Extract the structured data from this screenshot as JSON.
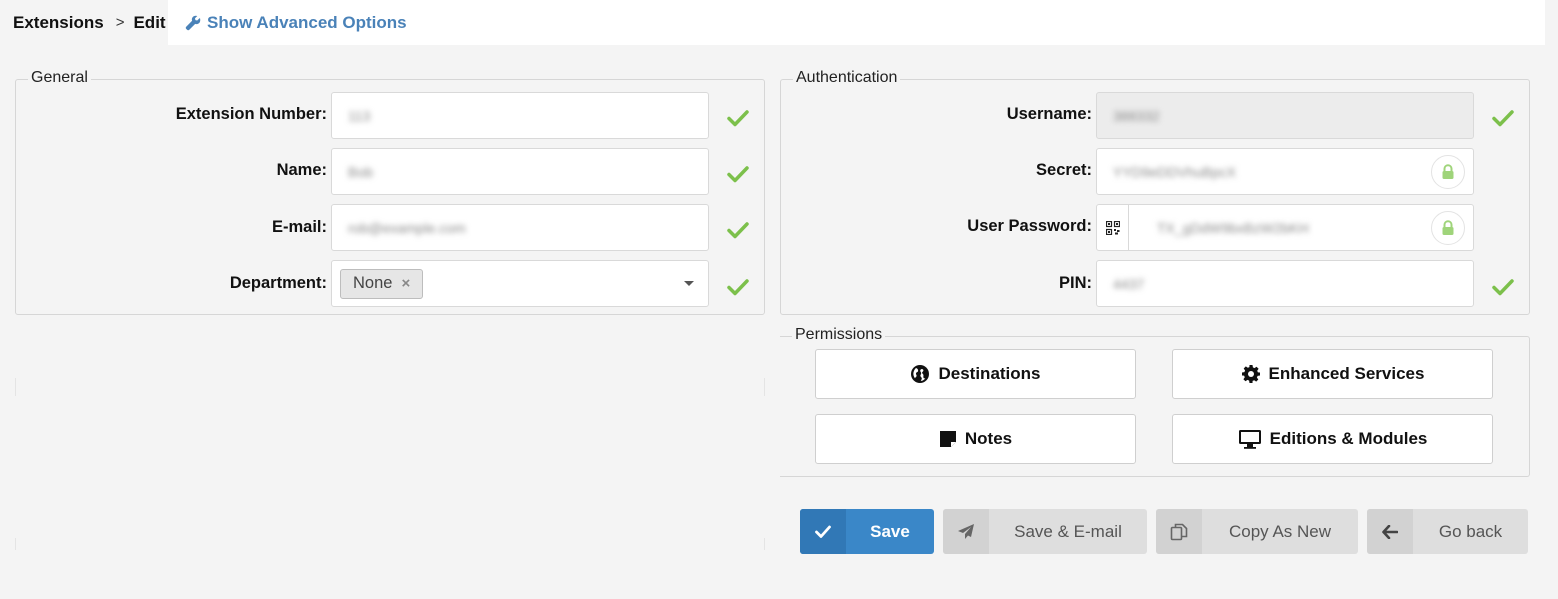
{
  "breadcrumb": {
    "root": "Extensions",
    "separator": ">",
    "current": "Edit"
  },
  "advanced_link": "Show Advanced Options",
  "general": {
    "legend": "General",
    "fields": {
      "extension_number": {
        "label": "Extension Number:",
        "value": "113"
      },
      "name": {
        "label": "Name:",
        "value": "Bob"
      },
      "email": {
        "label": "E-mail:",
        "value": "rob@example.com"
      },
      "department": {
        "label": "Department:",
        "value": "None"
      }
    }
  },
  "authentication": {
    "legend": "Authentication",
    "fields": {
      "username": {
        "label": "Username:",
        "value": "388332"
      },
      "secret": {
        "label": "Secret:",
        "value": "YYD9eDDVhuBpcX"
      },
      "user_password": {
        "label": "User Password:",
        "value": "TX_gDdW9bxBzW2bKH"
      },
      "pin": {
        "label": "PIN:",
        "value": "4437"
      }
    }
  },
  "permissions": {
    "legend": "Permissions",
    "buttons": {
      "destinations": "Destinations",
      "enhanced_services": "Enhanced Services",
      "notes": "Notes",
      "editions_modules": "Editions & Modules"
    }
  },
  "actions": {
    "save": "Save",
    "save_email": "Save & E-mail",
    "copy_as_new": "Copy As New",
    "go_back": "Go back"
  },
  "colors": {
    "accent": "#3a87c8",
    "link": "#4a82b8",
    "valid": "#7cc04b",
    "lock": "#9fd47a"
  },
  "icons": {
    "advanced": "wrench-icon",
    "valid": "check-icon",
    "lock": "lock-icon",
    "qr": "qr-code-icon",
    "destinations": "globe-icon",
    "enhanced_services": "gear-icon",
    "notes": "note-icon",
    "editions_modules": "monitor-icon",
    "save": "check-icon",
    "save_email": "paper-plane-icon",
    "copy_as_new": "copy-icon",
    "go_back": "arrow-left-icon"
  }
}
